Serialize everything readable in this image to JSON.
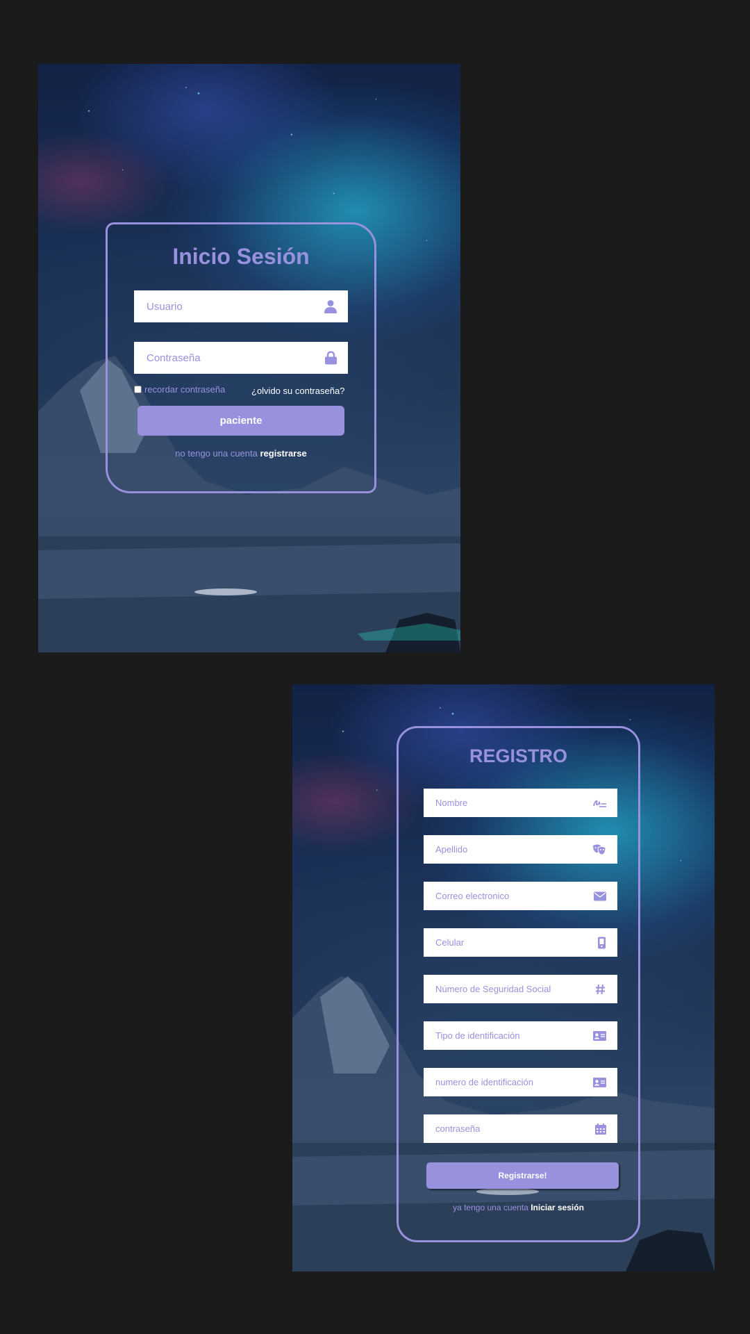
{
  "colors": {
    "accent": "#9891de",
    "page_background": "#1c1b1c",
    "field_background": "#ffffff"
  },
  "login": {
    "title": "Inicio Sesión",
    "username": {
      "placeholder": "Usuario",
      "icon": "user-icon"
    },
    "password": {
      "placeholder": "Contraseña",
      "icon": "lock-icon"
    },
    "remember_label": "recordar contraseña",
    "forgot_link": "¿olvido su contraseña?",
    "submit_label": "paciente",
    "no_account_text": "no tengo una cuenta",
    "register_link": "registrarse"
  },
  "register": {
    "title": "REGISTRO",
    "fields": [
      {
        "placeholder": "Nombre",
        "icon": "signature-icon"
      },
      {
        "placeholder": "Apellido",
        "icon": "masks-icon"
      },
      {
        "placeholder": "Correo electronico",
        "icon": "envelope-icon"
      },
      {
        "placeholder": "Celular",
        "icon": "mobile-icon"
      },
      {
        "placeholder": "Número de Seguridad Social",
        "icon": "hashtag-icon"
      },
      {
        "placeholder": "Tipo de identificación",
        "icon": "id-card-icon"
      },
      {
        "placeholder": "numero de identificación",
        "icon": "id-card-icon"
      },
      {
        "placeholder": "contraseña",
        "icon": "calendar-icon"
      }
    ],
    "submit_label": "Registrarse!",
    "have_account_text": "ya tengo una cuenta",
    "login_link": "Iniciar sesión"
  }
}
